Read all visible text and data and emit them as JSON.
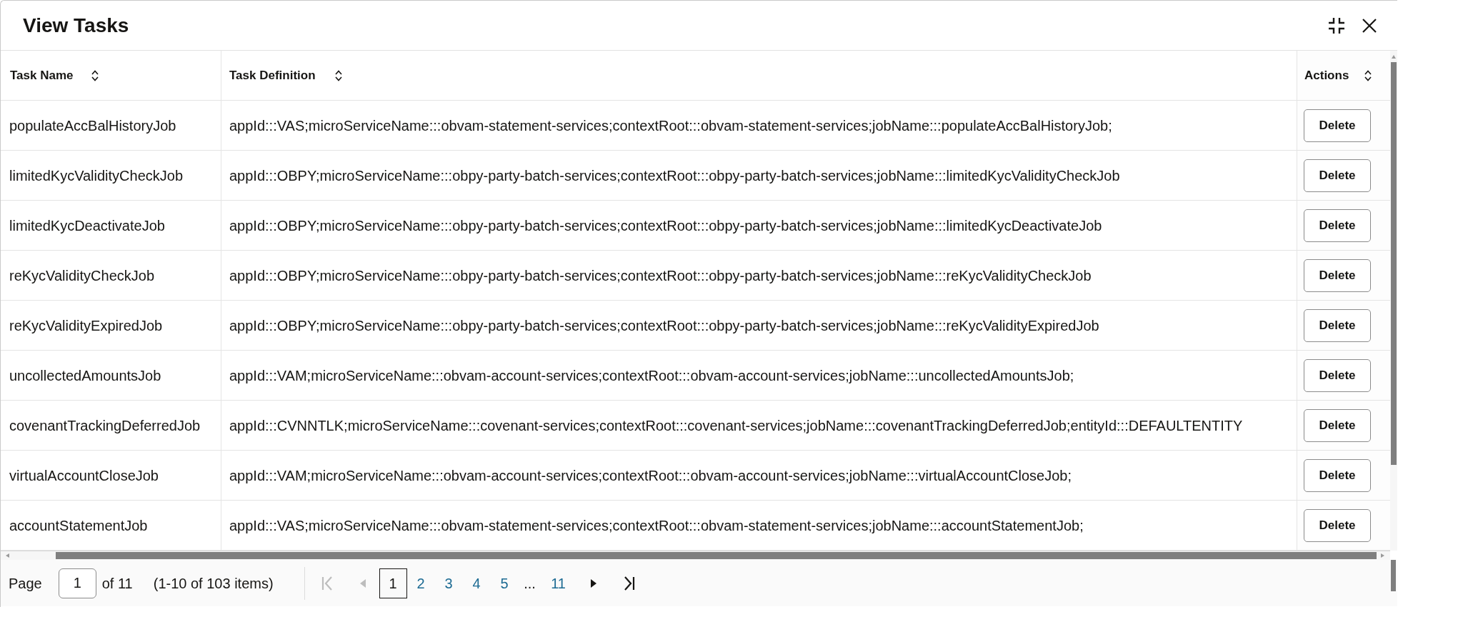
{
  "dialog": {
    "title": "View Tasks"
  },
  "table": {
    "columns": [
      {
        "label": "Task Name"
      },
      {
        "label": "Task Definition"
      },
      {
        "label": "Actions"
      }
    ],
    "rows": [
      {
        "task_name": "populateAccBalHistoryJob",
        "task_definition": "appId:::VAS;microServiceName:::obvam-statement-services;contextRoot:::obvam-statement-services;jobName:::populateAccBalHistoryJob;",
        "action": "Delete"
      },
      {
        "task_name": "limitedKycValidityCheckJob",
        "task_definition": "appId:::OBPY;microServiceName:::obpy-party-batch-services;contextRoot:::obpy-party-batch-services;jobName:::limitedKycValidityCheckJob",
        "action": "Delete"
      },
      {
        "task_name": "limitedKycDeactivateJob",
        "task_definition": "appId:::OBPY;microServiceName:::obpy-party-batch-services;contextRoot:::obpy-party-batch-services;jobName:::limitedKycDeactivateJob",
        "action": "Delete"
      },
      {
        "task_name": "reKycValidityCheckJob",
        "task_definition": "appId:::OBPY;microServiceName:::obpy-party-batch-services;contextRoot:::obpy-party-batch-services;jobName:::reKycValidityCheckJob",
        "action": "Delete"
      },
      {
        "task_name": "reKycValidityExpiredJob",
        "task_definition": "appId:::OBPY;microServiceName:::obpy-party-batch-services;contextRoot:::obpy-party-batch-services;jobName:::reKycValidityExpiredJob",
        "action": "Delete"
      },
      {
        "task_name": "uncollectedAmountsJob",
        "task_definition": "appId:::VAM;microServiceName:::obvam-account-services;contextRoot:::obvam-account-services;jobName:::uncollectedAmountsJob;",
        "action": "Delete"
      },
      {
        "task_name": "covenantTrackingDeferredJob",
        "task_definition": "appId:::CVNNTLK;microServiceName:::covenant-services;contextRoot:::covenant-services;jobName:::covenantTrackingDeferredJob;entityId:::DEFAULTENTITY",
        "action": "Delete"
      },
      {
        "task_name": "virtualAccountCloseJob",
        "task_definition": "appId:::VAM;microServiceName:::obvam-account-services;contextRoot:::obvam-account-services;jobName:::virtualAccountCloseJob;",
        "action": "Delete"
      },
      {
        "task_name": "accountStatementJob",
        "task_definition": "appId:::VAS;microServiceName:::obvam-statement-services;contextRoot:::obvam-statement-services;jobName:::accountStatementJob;",
        "action": "Delete"
      }
    ]
  },
  "pagination": {
    "label": "Page",
    "page_input": "1",
    "total": "of 11",
    "range": "(1-10 of 103 items)",
    "nav_start": [
      {
        "kind": "first",
        "disabled": true
      },
      {
        "kind": "previous",
        "disabled": true
      }
    ],
    "pages": [
      {
        "kind": "page",
        "label": "1",
        "selected": true
      },
      {
        "kind": "page",
        "label": "2",
        "selected": false
      },
      {
        "kind": "page",
        "label": "3",
        "selected": false
      },
      {
        "kind": "page",
        "label": "4",
        "selected": false
      },
      {
        "kind": "page",
        "label": "5",
        "selected": false
      },
      {
        "kind": "ellipsis",
        "label": "...",
        "selected": false
      },
      {
        "kind": "page",
        "label": "11",
        "selected": false
      }
    ],
    "nav_end": [
      {
        "kind": "next",
        "disabled": false
      },
      {
        "kind": "last",
        "disabled": false
      }
    ]
  }
}
